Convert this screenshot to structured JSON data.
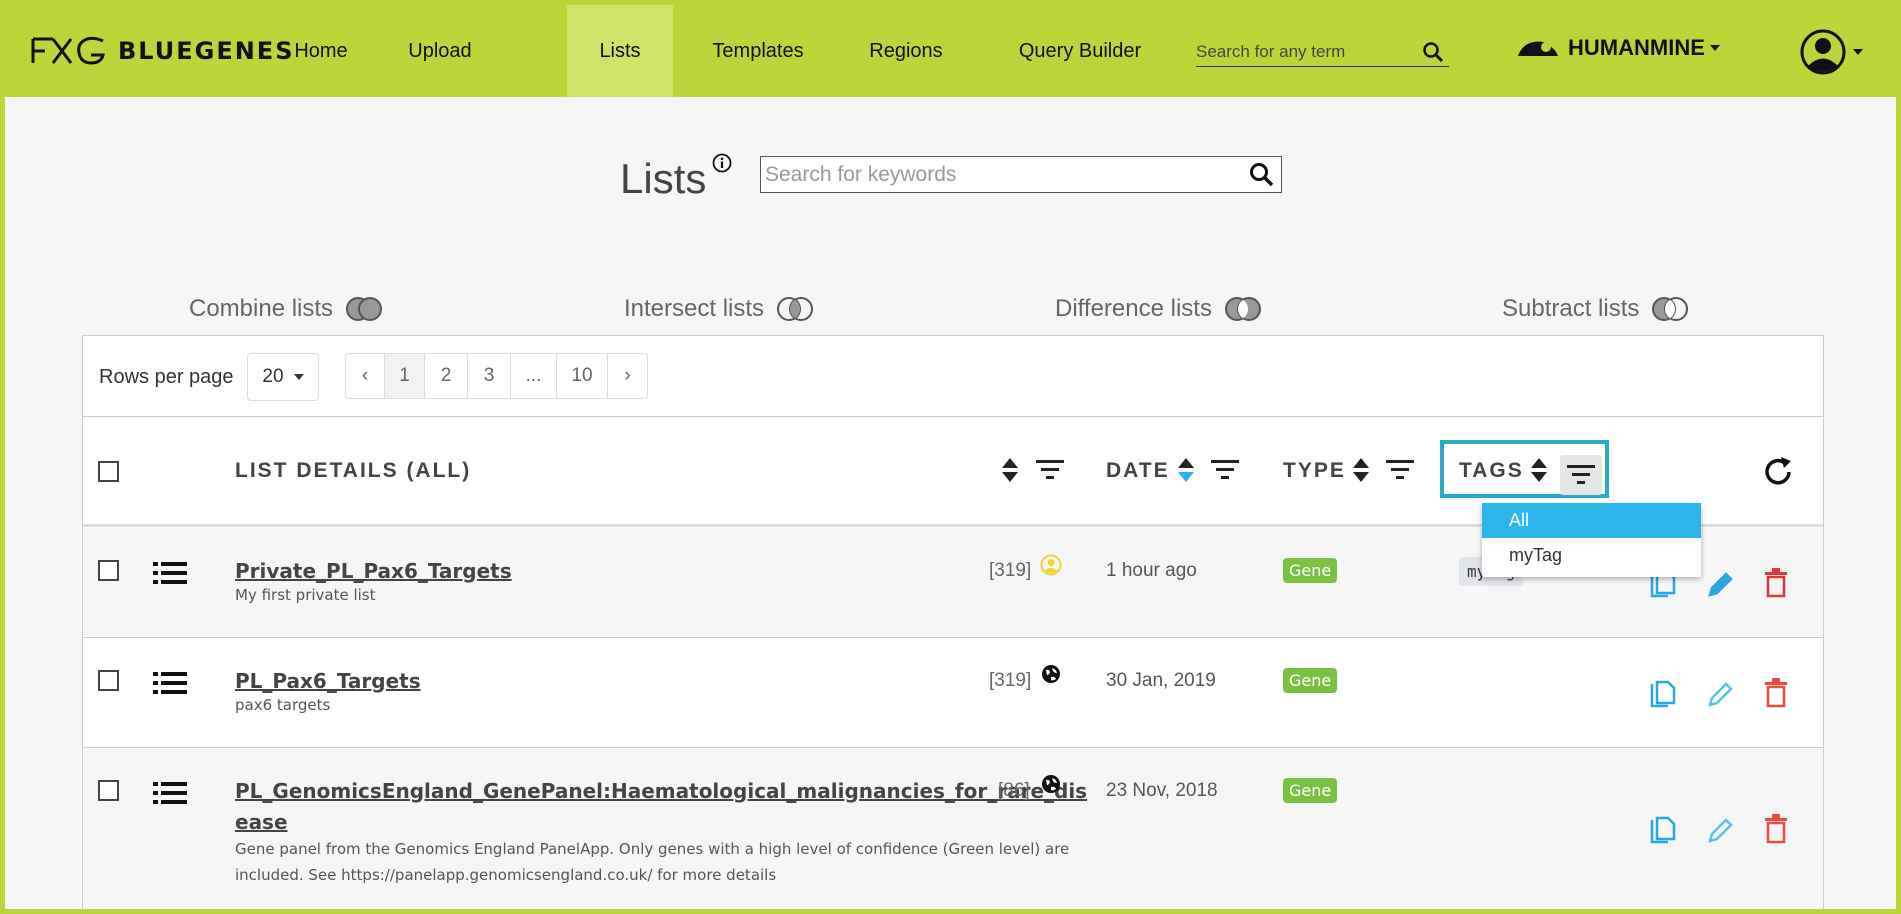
{
  "colors": {
    "accent": "#bcd63a",
    "active_nav": "#cde36a",
    "highlight": "#2aa9c9",
    "gene_badge": "#7ac143",
    "copy": "#2aa7e0",
    "edit": "#5bc0eb",
    "delete": "#e74c3c"
  },
  "nav": {
    "brand": "BLUEGENES",
    "items": [
      {
        "label": "Home"
      },
      {
        "label": "Upload"
      },
      {
        "label": "Lists"
      },
      {
        "label": "Templates"
      },
      {
        "label": "Regions"
      },
      {
        "label": "Query Builder"
      }
    ],
    "search_placeholder": "Search for any term",
    "mine_name": "HUMANMINE"
  },
  "page": {
    "title": "Lists",
    "search_placeholder": "Search for keywords"
  },
  "operations": [
    {
      "label": "Combine lists"
    },
    {
      "label": "Intersect lists"
    },
    {
      "label": "Difference lists"
    },
    {
      "label": "Subtract lists"
    }
  ],
  "pager": {
    "rows_label": "Rows per page",
    "rows_value": "20",
    "prev": "‹",
    "pages": [
      "1",
      "2",
      "3",
      "...",
      "10"
    ],
    "next": "›"
  },
  "columns": {
    "details": "LIST DETAILS (ALL)",
    "date": "DATE",
    "type": "TYPE",
    "tags": "TAGS"
  },
  "tag_filter": {
    "options": [
      "All",
      "myTag"
    ],
    "selected": "All"
  },
  "rows": [
    {
      "name": "Private_PL_Pax6_Targets",
      "description": "My first private list",
      "count": "[319]",
      "visibility_icon": "private-user-icon",
      "date": "1 hour ago",
      "type": "Gene",
      "tag": "myTag"
    },
    {
      "name": "PL_Pax6_Targets",
      "description": "pax6 targets",
      "count": "[319]",
      "visibility_icon": "public-globe-icon",
      "date": "30 Jan, 2019",
      "type": "Gene",
      "tag": ""
    },
    {
      "name_line1": "PL_GenomicsEngland_GenePanel:Haematological_malignancies_for_rare_dis",
      "name_line2": "ease",
      "description_line1": "Gene panel from the Genomics England PanelApp. Only genes with a high level of confidence (Green level) are",
      "description_line2": "included. See https://panelapp.genomicsengland.co.uk/ for more details",
      "count": "[86]",
      "visibility_icon": "public-globe-icon",
      "date": "23 Nov, 2018",
      "type": "Gene",
      "tag": ""
    }
  ]
}
